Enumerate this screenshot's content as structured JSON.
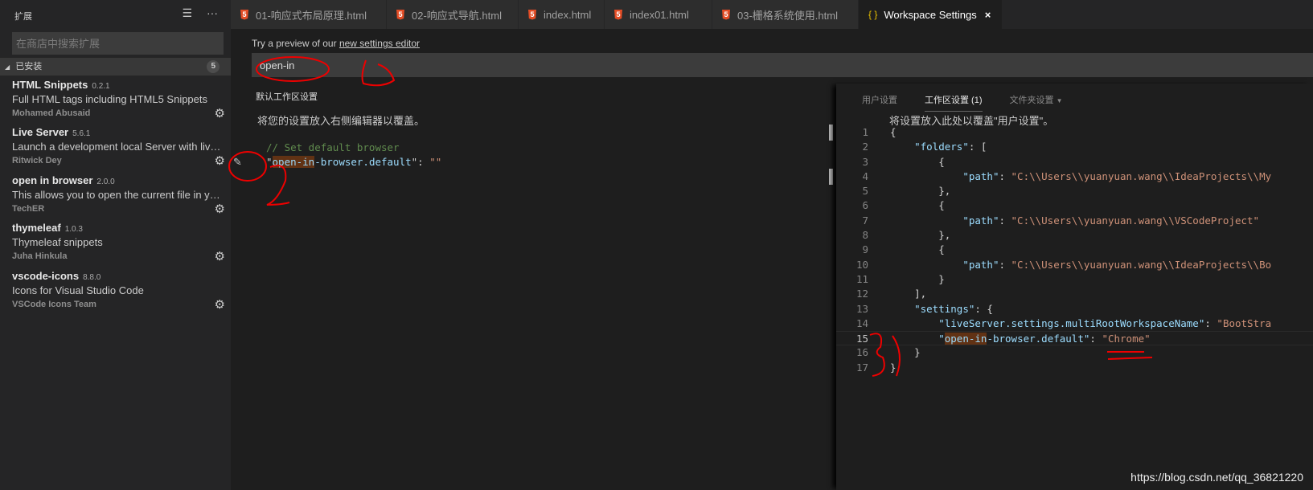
{
  "sidebar": {
    "title": "扩展",
    "search_placeholder": "在商店中搜索扩展",
    "section": {
      "label": "已安装",
      "count": "5"
    },
    "extensions": [
      {
        "name": "HTML Snippets",
        "version": "0.2.1",
        "description": "Full HTML tags including HTML5 Snippets",
        "publisher": "Mohamed Abusaid"
      },
      {
        "name": "Live Server",
        "version": "5.6.1",
        "description": "Launch a development local Server with live re...",
        "publisher": "Ritwick Dey"
      },
      {
        "name": "open in browser",
        "version": "2.0.0",
        "description": "This allows you to open the current file in you...",
        "publisher": "TechER"
      },
      {
        "name": "thymeleaf",
        "version": "1.0.3",
        "description": "Thymeleaf snippets",
        "publisher": "Juha Hinkula"
      },
      {
        "name": "vscode-icons",
        "version": "8.8.0",
        "description": "Icons for Visual Studio Code",
        "publisher": "VSCode Icons Team"
      }
    ]
  },
  "tabs": [
    {
      "label": "01-响应式布局原理.html",
      "icon": "html5-icon"
    },
    {
      "label": "02-响应式导航.html",
      "icon": "html5-icon"
    },
    {
      "label": "index.html",
      "icon": "html5-icon"
    },
    {
      "label": "index01.html",
      "icon": "html5-icon"
    },
    {
      "label": "03-栅格系统使用.html",
      "icon": "html5-icon"
    },
    {
      "label": "Workspace Settings",
      "icon": "braces-icon",
      "active": true,
      "braces": "{ }",
      "close": "×"
    }
  ],
  "settings": {
    "preview_text": "Try a preview of our ",
    "preview_link": "new settings editor",
    "search_value": "open-in",
    "default_title": "默认工作区设置",
    "default_hint": "将您的设置放入右侧编辑器以覆盖。",
    "default_comment": "// Set default browser",
    "default_key": "open-in-browser.default",
    "default_key_match": "open-in",
    "default_key_rest": "-browser.default",
    "default_value": "\"\""
  },
  "right": {
    "tabs": [
      "用户设置",
      "工作区设置 (1)",
      "文件夹设置"
    ],
    "dropdown": "▼",
    "hint": "将设置放入此处以覆盖\"用户设置\"。",
    "lines": [
      {
        "n": "1",
        "text": "{"
      },
      {
        "n": "2",
        "text": "    \"folders\": ["
      },
      {
        "n": "3",
        "text": "        {"
      },
      {
        "n": "4",
        "text": "            \"path\": \"C:\\\\Users\\\\yuanyuan.wang\\\\IdeaProjects\\\\My"
      },
      {
        "n": "5",
        "text": "        },"
      },
      {
        "n": "6",
        "text": "        {"
      },
      {
        "n": "7",
        "text": "            \"path\": \"C:\\\\Users\\\\yuanyuan.wang\\\\VSCodeProject\""
      },
      {
        "n": "8",
        "text": "        },"
      },
      {
        "n": "9",
        "text": "        {"
      },
      {
        "n": "10",
        "text": "            \"path\": \"C:\\\\Users\\\\yuanyuan.wang\\\\IdeaProjects\\\\Bo"
      },
      {
        "n": "11",
        "text": "        }"
      },
      {
        "n": "12",
        "text": "    ],"
      },
      {
        "n": "13",
        "text": "    \"settings\": {"
      },
      {
        "n": "14",
        "text": "        \"liveServer.settings.multiRootWorkspaceName\": \"BootStra"
      },
      {
        "n": "15",
        "text": "        \"open-in-browser.default\": \"Chrome\""
      },
      {
        "n": "16",
        "text": "    }"
      },
      {
        "n": "17",
        "text": "}"
      }
    ]
  },
  "watermark": "https://blog.csdn.net/qq_36821220",
  "annotations": [
    "1",
    "2",
    "3"
  ]
}
